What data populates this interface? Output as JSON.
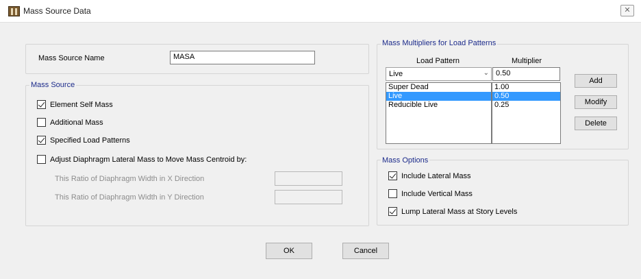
{
  "window": {
    "title": "Mass Source Data",
    "close_glyph": "✕"
  },
  "name_row": {
    "label": "Mass Source Name",
    "value": "MASA"
  },
  "mass_source": {
    "title": "Mass Source",
    "element_self_mass": {
      "label": "Element Self Mass",
      "checked": true
    },
    "additional_mass": {
      "label": "Additional Mass",
      "checked": false
    },
    "specified_load_patterns": {
      "label": "Specified Load Patterns",
      "checked": true
    },
    "adjust_diaphragm": {
      "label": "Adjust Diaphragm Lateral Mass to Move Mass Centroid by:",
      "checked": false
    },
    "ratio_x": {
      "label": "This Ratio of Diaphragm Width in X Direction",
      "value": ""
    },
    "ratio_y": {
      "label": "This Ratio of Diaphragm Width in Y Direction",
      "value": ""
    }
  },
  "multipliers": {
    "title": "Mass Multipliers for Load Patterns",
    "col_load_pattern": "Load Pattern",
    "col_multiplier": "Multiplier",
    "selected_pattern": "Live",
    "selected_multiplier": "0.50",
    "rows": [
      {
        "pattern": "Super Dead",
        "multiplier": "1.00",
        "selected": false
      },
      {
        "pattern": "Live",
        "multiplier": "0.50",
        "selected": true
      },
      {
        "pattern": "Reducible Live",
        "multiplier": "0.25",
        "selected": false
      }
    ],
    "add_label": "Add",
    "modify_label": "Modify",
    "delete_label": "Delete"
  },
  "mass_options": {
    "title": "Mass Options",
    "include_lateral": {
      "label": "Include Lateral Mass",
      "checked": true
    },
    "include_vertical": {
      "label": "Include Vertical Mass",
      "checked": false
    },
    "lump_lateral": {
      "label": "Lump Lateral Mass at Story Levels",
      "checked": true
    }
  },
  "footer": {
    "ok_label": "OK",
    "cancel_label": "Cancel"
  },
  "colors": {
    "group_title": "#1b2a8a",
    "selection": "#3399ff",
    "background": "#f0f0f0"
  }
}
